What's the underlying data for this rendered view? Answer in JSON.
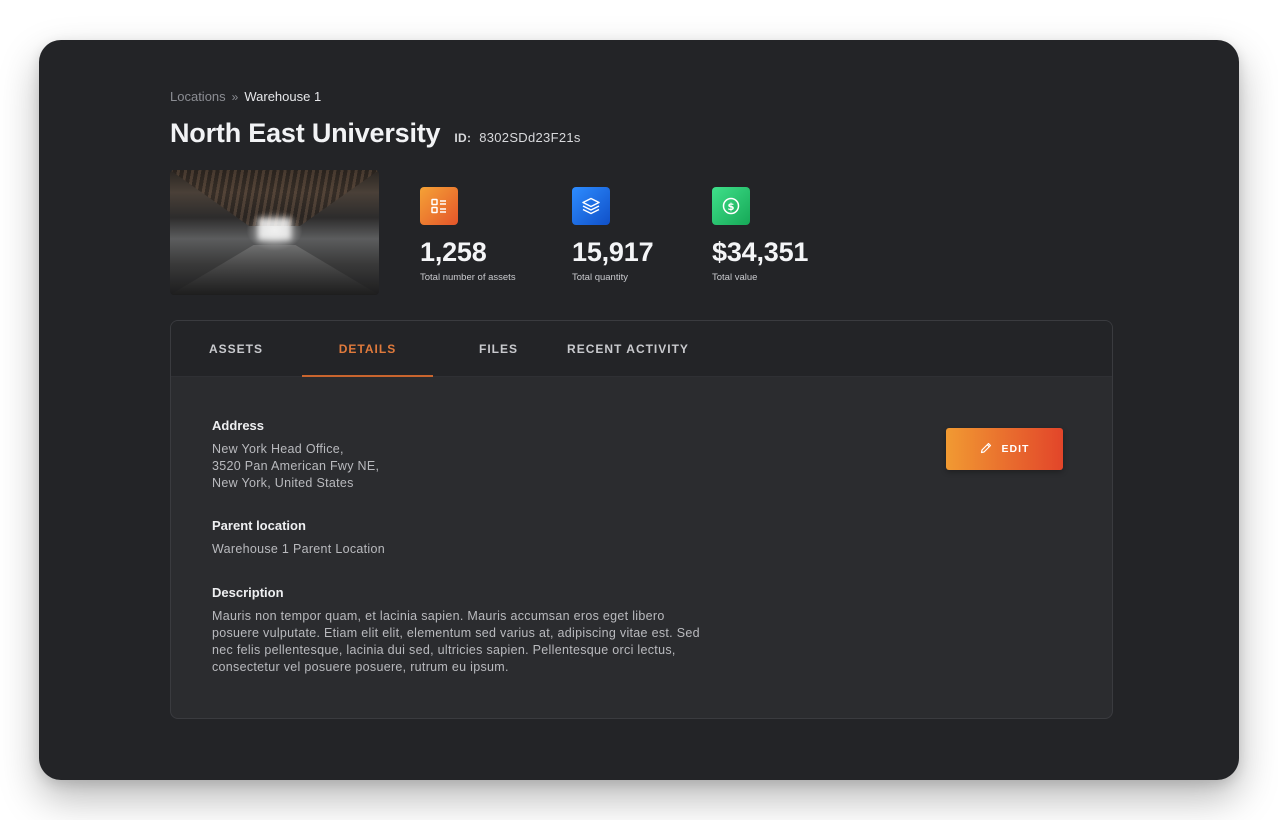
{
  "breadcrumb": {
    "root": "Locations",
    "separator": "»",
    "current": "Warehouse 1"
  },
  "header": {
    "title": "North East University",
    "id_label": "ID:",
    "id_value": "8302SDd23F21s"
  },
  "stats": [
    {
      "icon": "list-icon",
      "color": "#f08a30",
      "value": "1,258",
      "label": "Total number of assets"
    },
    {
      "icon": "layers-icon",
      "color": "#1f6fe8",
      "value": "15,917",
      "label": "Total quantity"
    },
    {
      "icon": "dollar-circle-icon",
      "color": "#22c46a",
      "value": "$34,351",
      "label": "Total value"
    }
  ],
  "tabs": [
    {
      "label": "ASSETS",
      "active": false
    },
    {
      "label": "DETAILS",
      "active": true
    },
    {
      "label": "FILES",
      "active": false
    },
    {
      "label": "RECENT ACTIVITY",
      "active": false
    }
  ],
  "details": {
    "address_label": "Address",
    "address_lines": [
      "New York Head Office,",
      "3520 Pan American Fwy NE,",
      "New York, United States"
    ],
    "parent_label": "Parent location",
    "parent_value": "Warehouse 1 Parent Location",
    "description_label": "Description",
    "description_lines": [
      "Mauris non tempor quam, et lacinia sapien. Mauris accumsan eros eget libero",
      "posuere vulputate. Etiam elit elit, elementum sed varius at, adipiscing vitae est. Sed",
      "nec felis pellentesque, lacinia dui sed, ultricies sapien. Pellentesque orci lectus,",
      "consectetur vel posuere posuere, rutrum eu ipsum."
    ]
  },
  "edit_button": {
    "label": "EDIT",
    "icon": "pencil-icon"
  },
  "colors": {
    "accent": "#e07a3c",
    "background": "#232427",
    "card": "#2b2c2f"
  }
}
